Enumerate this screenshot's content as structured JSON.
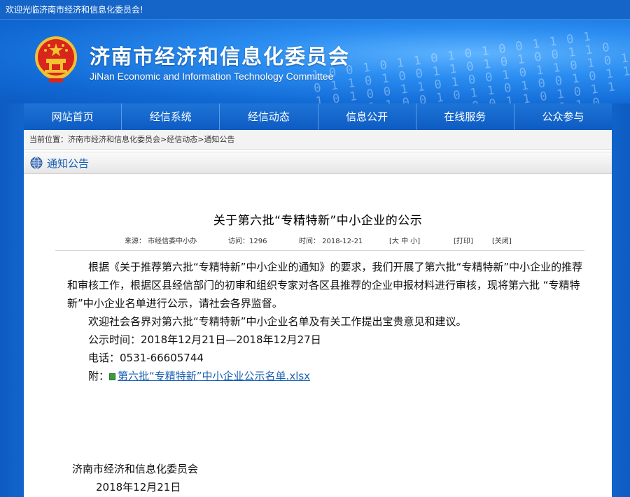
{
  "topbar": {
    "welcome": "欢迎光临济南市经济和信息化委员会!"
  },
  "banner": {
    "title": "济南市经济和信息化委员会",
    "subtitle": "JiNan Economic and Information Technology Committee"
  },
  "nav": {
    "items": [
      {
        "label": "网站首页"
      },
      {
        "label": "经信系统"
      },
      {
        "label": "经信动态"
      },
      {
        "label": "信息公开"
      },
      {
        "label": "在线服务"
      },
      {
        "label": "公众参与"
      }
    ]
  },
  "breadcrumb": {
    "prefix": "当前位置：",
    "home": "济南市经济和信息化委员会",
    "sep1": ">",
    "section": "经信动态",
    "sep2": ">",
    "current": "通知公告"
  },
  "section": {
    "title": "通知公告"
  },
  "article": {
    "title": "关于第六批“专精特新”中小企业的公示",
    "meta": {
      "source": "来源：  市经信委中小办",
      "visits": "访问：1296",
      "time": "时间：  2018-12-21",
      "font_size": "[大   中   小]",
      "print": "[打印]",
      "close": "[关闭]"
    },
    "para1": "根据《关于推荐第六批“专精特新”中小企业的通知》的要求，我们开展了第六批“专精特新”中小企业的推荐和审核工作，根据区县经信部门的初审和组织专家对各区县推荐的企业申报材料进行审核，现将第六批 “专精特新”中小企业名单进行公示，请社会各界监督。",
    "para2": "欢迎社会各界对第六批“专精特新”中小企业名单及有关工作提出宝贵意见和建议。",
    "period": "公示时间：2018年12月21日—2018年12月27日",
    "phone": "电话：0531-66605744",
    "attach_label": "附：",
    "attach_name": "第六批“专精特新”中小企业公示名单.xlsx",
    "sign_org": "济南市经济和信息化委员会",
    "sign_date": "2018年12月21日"
  },
  "colors": {
    "brand_blue": "#0d5bc3",
    "link_blue": "#1a5fb4",
    "emblem_red": "#d8261c",
    "emblem_gold": "#f2c230"
  }
}
